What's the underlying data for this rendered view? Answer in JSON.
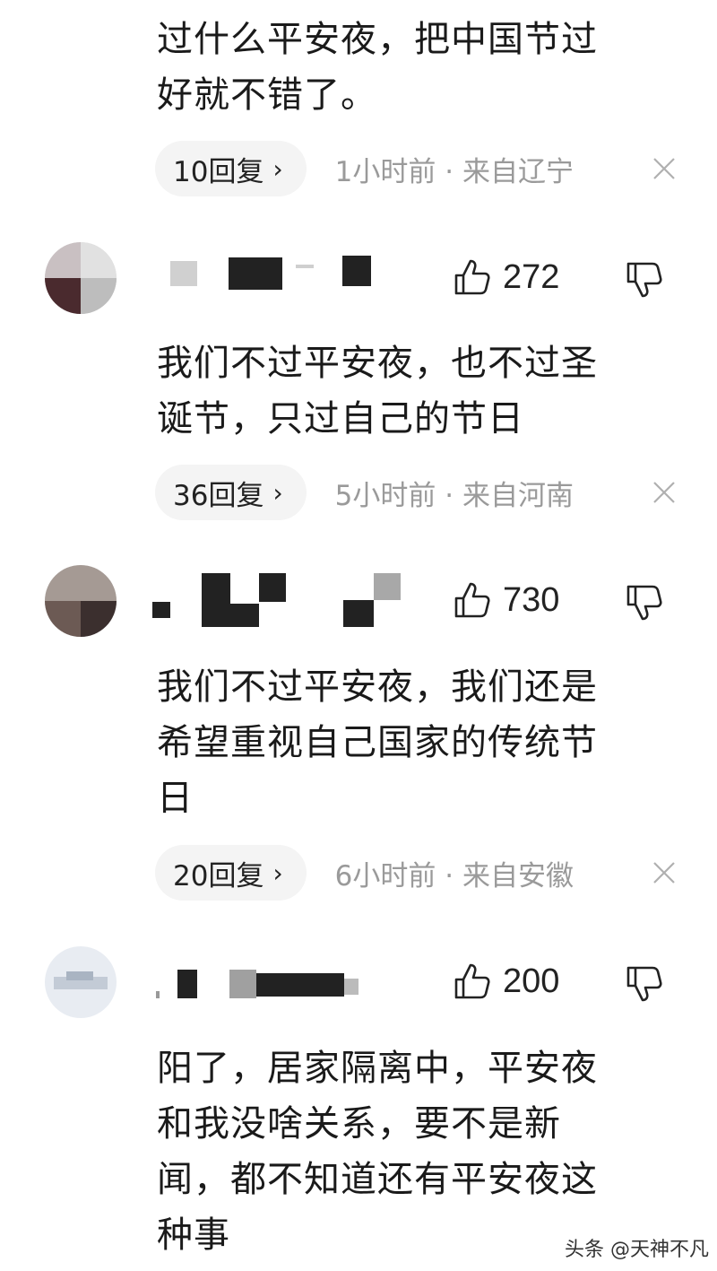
{
  "comments": [
    {
      "text_lines": [
        "过什么平安夜，把中国节过",
        "好就不错了。"
      ],
      "reply_label": "10回复",
      "time_location": "1小时前 · 来自辽宁"
    },
    {
      "likes": "272",
      "text_lines": [
        "我们不过平安夜，也不过圣",
        "诞节，只过自己的节日"
      ],
      "reply_label": "36回复",
      "time_location": "5小时前 · 来自河南"
    },
    {
      "likes": "730",
      "text_lines": [
        "我们不过平安夜，我们还是",
        "希望重视自己国家的传统节",
        "日"
      ],
      "reply_label": "20回复",
      "time_location": "6小时前 · 来自安徽"
    },
    {
      "likes": "200",
      "text_lines": [
        "阳了，居家隔离中，平安夜",
        "和我没啥关系，要不是新",
        "闻，都不知道还有平安夜这",
        "种事"
      ]
    }
  ],
  "chevron": "›",
  "watermark": "头条 @天神不凡",
  "icons": {
    "like": "thumbs-up-icon",
    "dislike": "thumbs-down-icon",
    "close": "close-icon"
  },
  "colors": {
    "text": "#1a1a1a",
    "meta": "#9a9a9a",
    "pill_bg": "#f4f4f4",
    "censor": "#222222"
  }
}
